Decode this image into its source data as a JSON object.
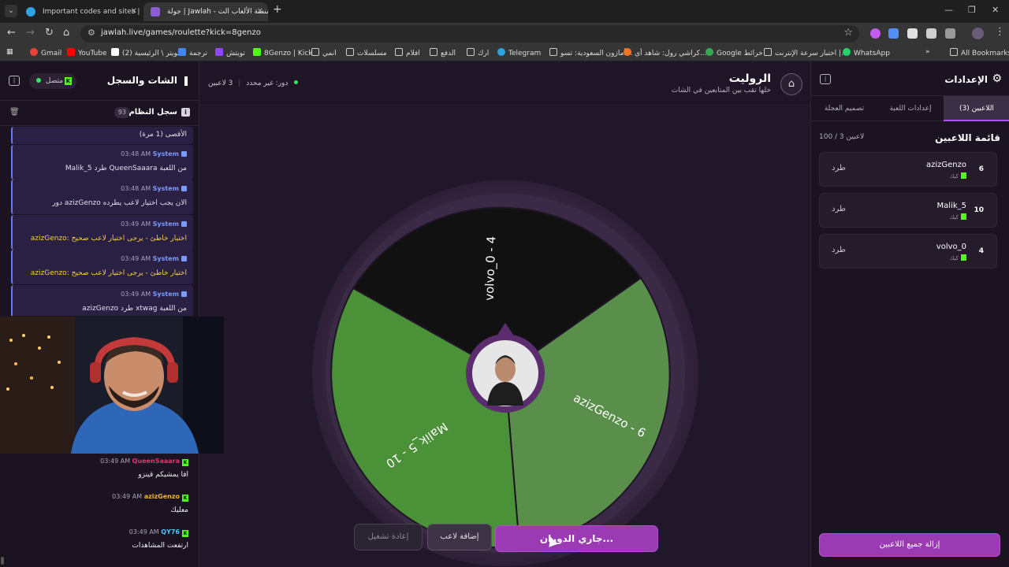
{
  "browser": {
    "tabs": [
      {
        "title": "Important codes and sites | ...",
        "active": false
      },
      {
        "title": "جولة | Jawlah - منصة الألعاب الت...",
        "active": true
      }
    ],
    "url": "jawlah.live/games/roulette?kick=8genzo",
    "bookmarks": [
      "Gmail",
      "YouTube",
      "(2) تويتر \\ الرئيسية",
      "ترجمة",
      "تويتش",
      "8Genzo | Kick",
      "انمي",
      "مسلسلات",
      "افلام",
      "الدفع",
      "ارك",
      "Telegram",
      "أمازون السعودية: تسو...",
      "كراشي رول: شاهد أي...",
      "Google خرائط",
      "اختبار سرعة الإنترنت |...",
      "WhatsApp",
      "All Bookmarks"
    ]
  },
  "chat": {
    "title": "الشات والسجل",
    "status": "متصل",
    "log_title": "سجل النظام",
    "log_count": "93",
    "log": [
      {
        "user": "",
        "time": "",
        "text": "الأقصى (1 مرة)",
        "warn": false
      },
      {
        "user": "System",
        "time": "03:48 AM",
        "text": "Malik_5 طرد QueenSaaara من اللعبة",
        "warn": false
      },
      {
        "user": "System",
        "time": "03:48 AM",
        "text": "دور azizGenzo الان يجب اختيار لاعب يطرده",
        "warn": false
      },
      {
        "user": "System",
        "time": "03:49 AM",
        "text": "azizGenzo: اختيار خاطئ - يرجى اختيار لاعب صحيح",
        "warn": true
      },
      {
        "user": "System",
        "time": "03:49 AM",
        "text": "azizGenzo: اختيار خاطئ - يرجى اختيار لاعب صحيح",
        "warn": true
      },
      {
        "user": "System",
        "time": "03:49 AM",
        "text": "azizGenzo طرد xtwag من اللعبة",
        "warn": false
      }
    ],
    "messages": [
      {
        "user": "QueenSaaara",
        "time": "03:49 AM",
        "text": "افا يمشيكم قينزو",
        "color": "#e8336b"
      },
      {
        "user": "azizGenzo",
        "time": "03:49 AM",
        "text": "معليك",
        "color": "#f0b429"
      },
      {
        "user": "QY76",
        "time": "03:49 AM",
        "text": "ارتفعت المشاهدات",
        "color": "#4fc3f7"
      }
    ]
  },
  "main": {
    "title": "الروليت",
    "subtitle": "خلها تقب بين المتابعين في الشات",
    "players_online": "3 لاعبين",
    "turn": "دور: غير محدد",
    "wheel_segments": [
      {
        "label": "volvo_0 - 4",
        "color": "#111111"
      },
      {
        "label": "azizGenzo - 6",
        "color": "#5a8f4b"
      },
      {
        "label": "Malik_5 - 10",
        "color": "#4a9138"
      }
    ],
    "buttons": {
      "spin": "جاري الدوران...",
      "add": "إضافة لاعب",
      "reset": "إعادة تشغيل"
    }
  },
  "settings": {
    "title": "الإعدادات",
    "tabs": [
      "اللاعبين (3)",
      "إعدادات اللعبة",
      "تصميم العجلة"
    ],
    "list_title": "قائمة اللاعبين",
    "count": "100 / 3 لاعبين",
    "players": [
      {
        "name": "azizGenzo",
        "weight": "6",
        "source": "كيك",
        "kick_label": "طرد"
      },
      {
        "name": "Malik_5",
        "weight": "10",
        "source": "كيك",
        "kick_label": "طرد"
      },
      {
        "name": "volvo_0",
        "weight": "4",
        "source": "كيك",
        "kick_label": "طرد"
      }
    ],
    "remove_all": "إزالة جميع اللاعبين"
  }
}
